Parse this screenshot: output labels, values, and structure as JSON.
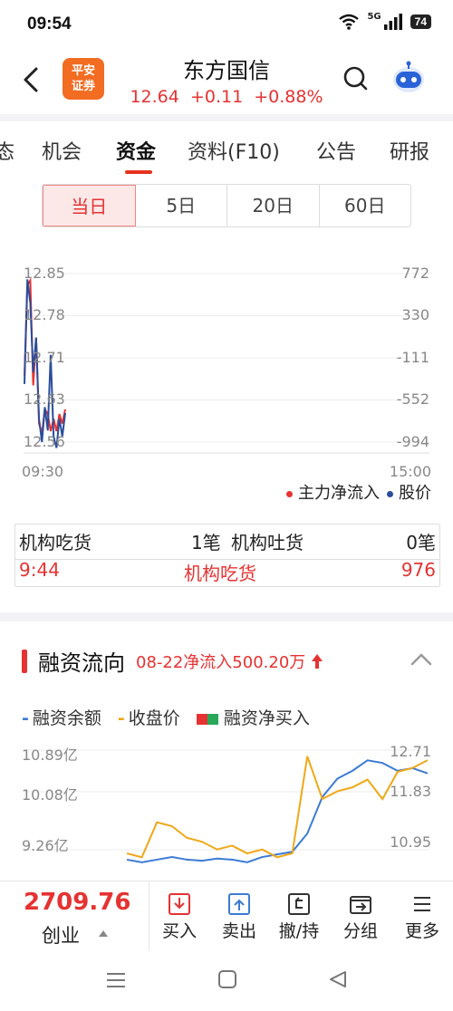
{
  "status": {
    "time": "09:54",
    "battery": "74",
    "net": "5G"
  },
  "header": {
    "broker_logo_line1": "平安",
    "broker_logo_line2": "证券",
    "stock_name": "东方国信",
    "price_line": "12.64  +0.11  +0.88%"
  },
  "tabs": [
    {
      "label": "态"
    },
    {
      "label": "机会"
    },
    {
      "label": "资金"
    },
    {
      "label": "资料(F10)"
    },
    {
      "label": "公告"
    },
    {
      "label": "研报"
    }
  ],
  "active_tab": "资金",
  "periods": [
    "当日",
    "5日",
    "20日",
    "60日"
  ],
  "active_period": "当日",
  "intraday_chart": {
    "left_ticks": [
      "12.85",
      "12.78",
      "12.71",
      "12.63",
      "12.56"
    ],
    "right_ticks": [
      "772",
      "330",
      "-111",
      "-552",
      "-994"
    ],
    "x_start": "09:30",
    "x_end": "15:00",
    "legend_main": "主力净流入",
    "legend_price": "股价",
    "main_color": "#e63232",
    "price_color": "#2a4d9c"
  },
  "chart_data": [
    {
      "type": "line",
      "title": "",
      "x": [
        "09:30",
        "09:31",
        "09:32",
        "09:33",
        "09:34",
        "09:35",
        "09:36",
        "09:37",
        "09:38",
        "09:39",
        "09:40",
        "09:41",
        "09:42",
        "09:43",
        "09:44"
      ],
      "series": [
        {
          "name": "主力净流入",
          "axis": "right",
          "values": [
            -300,
            650,
            700,
            -400,
            100,
            -800,
            -900,
            -650,
            -700,
            -880,
            -750,
            -880,
            -700,
            -800,
            -650
          ]
        },
        {
          "name": "股价",
          "axis": "left",
          "values": [
            12.66,
            12.84,
            12.8,
            12.68,
            12.74,
            12.6,
            12.56,
            12.62,
            12.58,
            12.71,
            12.57,
            12.55,
            12.6,
            12.57,
            12.61
          ]
        }
      ],
      "ylim_left": [
        12.56,
        12.85
      ],
      "ylim_right": [
        -994,
        772
      ]
    },
    {
      "type": "line",
      "title": "融资流向",
      "series": [
        {
          "name": "融资余额",
          "axis": "left",
          "values": [
            8.9,
            8.85,
            8.9,
            8.95,
            8.9,
            8.88,
            8.92,
            8.9,
            8.85,
            8.95,
            9.0,
            9.05,
            9.4,
            10.1,
            10.45,
            10.6,
            10.8,
            10.75,
            10.6,
            10.65,
            10.55
          ]
        },
        {
          "name": "收盘价",
          "axis": "right",
          "values": [
            10.2,
            10.1,
            11.0,
            10.9,
            10.6,
            10.5,
            10.3,
            10.4,
            10.2,
            10.3,
            10.1,
            10.2,
            12.7,
            11.6,
            11.8,
            11.9,
            12.1,
            11.6,
            12.3,
            12.4,
            12.6
          ]
        }
      ],
      "left_ticks": [
        "10.89亿",
        "10.08亿",
        "9.26亿"
      ],
      "right_ticks": [
        "12.71",
        "11.83",
        "10.95"
      ]
    }
  ],
  "institution": {
    "buy_label": "机构吃货",
    "buy_count": "1笔",
    "sell_label": "机构吐货",
    "sell_count": "0笔",
    "row_time": "9:44",
    "row_type": "机构吃货",
    "row_value": "976"
  },
  "margin_flow": {
    "title": "融资流向",
    "summary": "08-22净流入500.20万",
    "legend_balance": "融资余额",
    "legend_close": "收盘价",
    "legend_net": "融资净买入",
    "balance_color": "#3b7bd4",
    "close_color": "#f0a818"
  },
  "bottom_bar": {
    "index_value": "2709.76",
    "index_name": "创业",
    "buttons": [
      "买入",
      "卖出",
      "撤/持",
      "分组",
      "更多"
    ]
  }
}
